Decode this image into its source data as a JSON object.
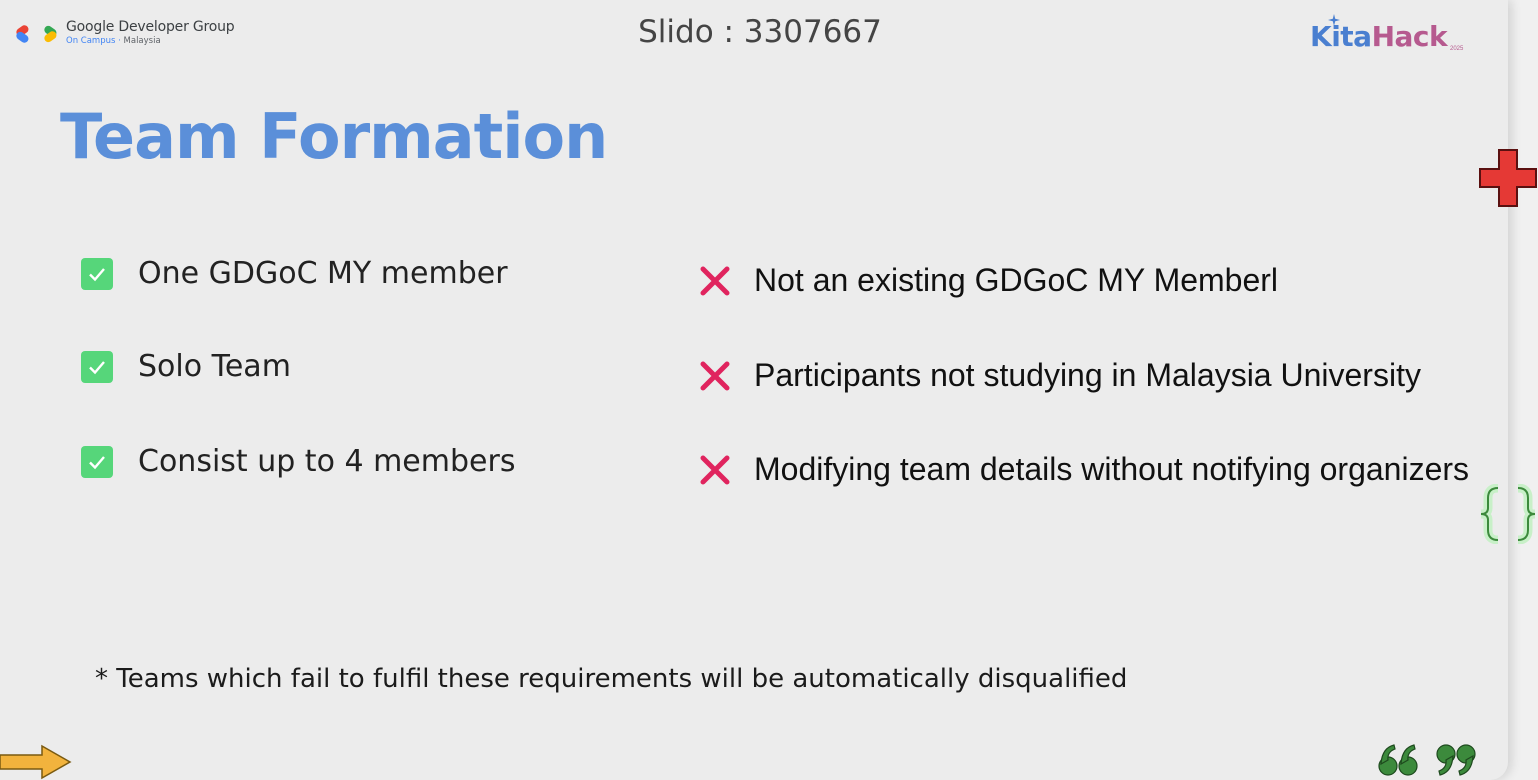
{
  "header": {
    "org_name": "Google Developer Group",
    "org_sub": "On Campus",
    "org_country": "Malaysia",
    "slido": "Slido : 3307667",
    "event_word_1": "Kita",
    "event_word_2": "Hack",
    "event_year": "2025"
  },
  "title": "Team Formation",
  "requirements": [
    "One GDGoC MY member",
    "Solo Team",
    "Consist up to 4 members"
  ],
  "disqualifications": [
    "Not an existing GDGoC MY Memberl",
    "Participants not studying in Malaysia University",
    "Modifying team details without notifying organizers"
  ],
  "footnote": "* Teams which fail to fulfil these requirements will be automatically disqualified",
  "colors": {
    "title": "#5b8fd9",
    "check": "#56d67a",
    "cross": "#e0245e",
    "plus": "#e53935",
    "braces": "#c8f0c8",
    "quotes": "#3c8a3c",
    "arrow": "#f2b33d"
  },
  "icons": {
    "requirement": "check-box-icon",
    "disqualification": "cross-icon",
    "decor": [
      "plus-icon",
      "braces-icon",
      "quote-icon",
      "arrow-icon"
    ]
  }
}
